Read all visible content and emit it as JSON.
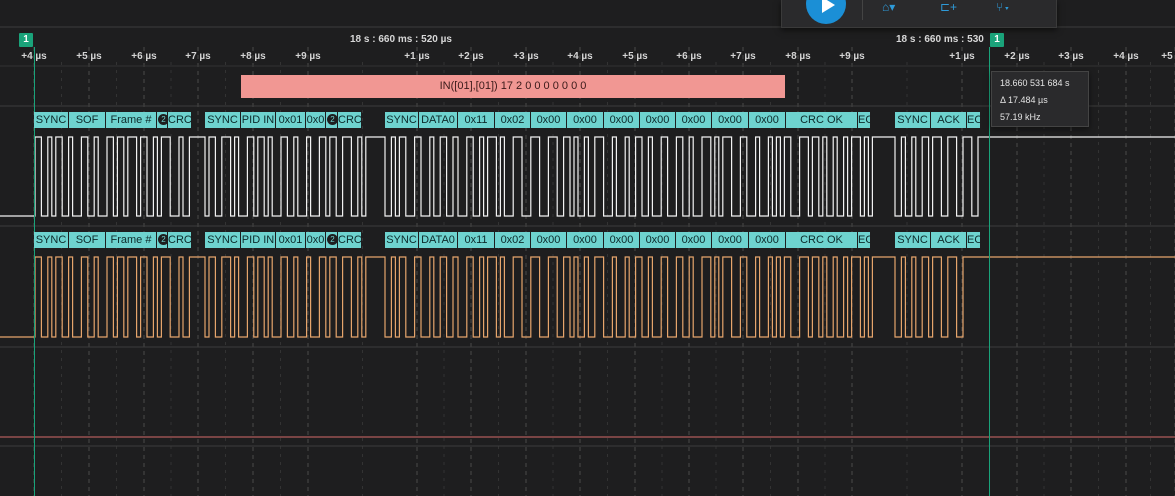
{
  "toolbar": {
    "play_icon": "play-icon",
    "icons": [
      "measure-icon",
      "marker-icon",
      "trigger-icon"
    ]
  },
  "ruler": {
    "timestamp_center": "18 s : 660 ms : 520 µs",
    "timestamp_right": "18 s : 660 ms : 530",
    "ticks": [
      "+4 µs",
      "+5 µs",
      "+6 µs",
      "+7 µs",
      "+8 µs",
      "+9 µs",
      "+1 µs",
      "+2 µs",
      "+3 µs",
      "+4 µs",
      "+5 µs",
      "+6 µs",
      "+7 µs",
      "+8 µs",
      "+9 µs",
      "+1 µs",
      "+2 µs",
      "+3 µs",
      "+4 µs",
      "+5"
    ]
  },
  "markers": {
    "left": "1",
    "right": "1"
  },
  "protocol_label": "IN([01],[01]) 17 2 0 0 0 0 0 0 0",
  "tooltip": {
    "time": "18.660 531 684 s",
    "delta": "Δ 17.484 µs",
    "freq": "57.19 kHz"
  },
  "decode_channel_1": [
    "SYNC",
    "SOF",
    "Frame #",
    "2",
    "CRC",
    "SYNC",
    "PID IN",
    "0x01",
    "0x0",
    "2",
    "CRC",
    "SYNC",
    "DATA0",
    "0x11",
    "0x02",
    "0x00",
    "0x00",
    "0x00",
    "0x00",
    "0x00",
    "0x00",
    "0x00",
    "CRC OK",
    "EO",
    "SYNC",
    "ACK",
    "EO"
  ],
  "decode_channel_2": [
    "SYNC",
    "SOF",
    "Frame #",
    "2",
    "CRC",
    "SYNC",
    "PID IN",
    "0x01",
    "0x0",
    "2",
    "CRC",
    "SYNC",
    "DATA0",
    "0x11",
    "0x02",
    "0x00",
    "0x00",
    "0x00",
    "0x00",
    "0x00",
    "0x00",
    "0x00",
    "CRC OK",
    "EO",
    "SYNC",
    "ACK",
    "EO"
  ],
  "colors": {
    "background": "#1e1e1f",
    "decode_teal": "#6ed3cf",
    "protocol_pink": "#f19793",
    "channel_1": "#f2f2f2",
    "channel_2": "#e6a56c",
    "marker_green": "#1aa37a",
    "accent_blue": "#1b8fd6"
  }
}
